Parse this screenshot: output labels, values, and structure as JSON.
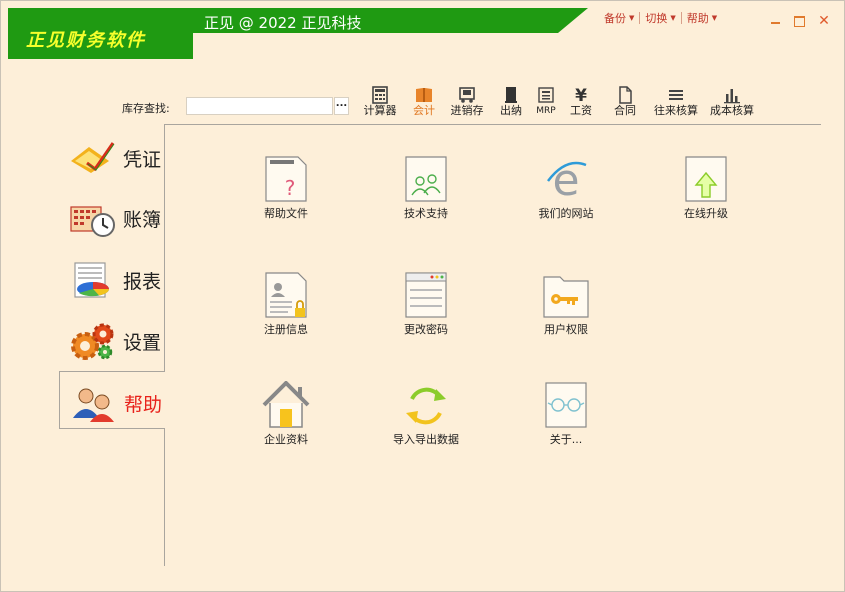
{
  "app": {
    "logo_text": "正见财务软件",
    "title": "正见 @ 2022 正见科技"
  },
  "top_menus": [
    {
      "label": "备份"
    },
    {
      "label": "切换"
    },
    {
      "label": "帮助"
    }
  ],
  "search": {
    "label": "库存查找:",
    "value": "",
    "button": "..."
  },
  "toolbar": [
    {
      "label": "计算器",
      "icon": "calculator-icon"
    },
    {
      "label": "会计",
      "icon": "book-icon",
      "active": true
    },
    {
      "label": "进销存",
      "icon": "inventory-icon"
    },
    {
      "label": "出纳",
      "icon": "cashier-icon"
    },
    {
      "label": "MRP",
      "icon": "mrp-icon"
    },
    {
      "label": "工资",
      "icon": "yen-icon"
    },
    {
      "label": "合同",
      "icon": "document-icon"
    },
    {
      "label": "往来核算",
      "icon": "list-icon"
    },
    {
      "label": "成本核算",
      "icon": "bar-chart-icon"
    }
  ],
  "sidebar": [
    {
      "label": "凭证",
      "icon": "voucher-icon"
    },
    {
      "label": "账簿",
      "icon": "ledger-icon"
    },
    {
      "label": "报表",
      "icon": "report-icon"
    },
    {
      "label": "设置",
      "icon": "gear-icon"
    },
    {
      "label": "帮助",
      "icon": "help-users-icon",
      "active": true
    }
  ],
  "main": {
    "items": [
      {
        "label": "帮助文件",
        "icon": "help-file-icon"
      },
      {
        "label": "技术支持",
        "icon": "support-icon"
      },
      {
        "label": "我们的网站",
        "icon": "website-icon"
      },
      {
        "label": "在线升级",
        "icon": "upgrade-icon"
      },
      {
        "label": "注册信息",
        "icon": "register-icon"
      },
      {
        "label": "更改密码",
        "icon": "password-icon"
      },
      {
        "label": "用户权限",
        "icon": "key-folder-icon"
      },
      {
        "label": "企业资料",
        "icon": "company-icon"
      },
      {
        "label": "导入导出数据",
        "icon": "import-export-icon"
      },
      {
        "label": "关于...",
        "icon": "about-icon"
      }
    ]
  },
  "colors": {
    "background": "#fdefd9",
    "title_band": "#1f9a12",
    "logo_text": "#f6ff2c",
    "menu_text": "#c0392b",
    "active_nav": "#e8221b",
    "active_tool": "#e0761f"
  }
}
